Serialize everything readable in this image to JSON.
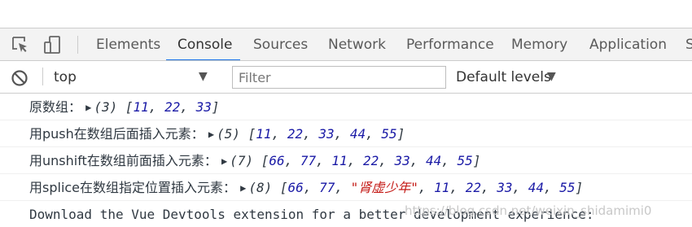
{
  "tabs": [
    {
      "label": "Elements",
      "active": false
    },
    {
      "label": "Console",
      "active": true
    },
    {
      "label": "Sources",
      "active": false
    },
    {
      "label": "Network",
      "active": false
    },
    {
      "label": "Performance",
      "active": false
    },
    {
      "label": "Memory",
      "active": false
    },
    {
      "label": "Application",
      "active": false
    },
    {
      "label": "S",
      "active": false
    }
  ],
  "toolbar": {
    "context": "top",
    "filter_placeholder": "Filter",
    "levels_label": "Default levels"
  },
  "icons": {
    "inspect": "inspect-element-icon",
    "device": "device-toolbar-icon",
    "clear": "clear-console-icon",
    "expand": "expand-triangle-icon"
  },
  "colors": {
    "number": "#1a1aa6",
    "string": "#c41a16",
    "active_tab_underline": "#1a73e8"
  },
  "console_lines": [
    {
      "message": "原数组：",
      "count": 3,
      "items": [
        {
          "type": "number",
          "value": "11"
        },
        {
          "type": "number",
          "value": "22"
        },
        {
          "type": "number",
          "value": "33"
        }
      ]
    },
    {
      "message": "用push在数组后面插入元素：",
      "count": 5,
      "items": [
        {
          "type": "number",
          "value": "11"
        },
        {
          "type": "number",
          "value": "22"
        },
        {
          "type": "number",
          "value": "33"
        },
        {
          "type": "number",
          "value": "44"
        },
        {
          "type": "number",
          "value": "55"
        }
      ]
    },
    {
      "message": "用unshift在数组前面插入元素：",
      "count": 7,
      "items": [
        {
          "type": "number",
          "value": "66"
        },
        {
          "type": "number",
          "value": "77"
        },
        {
          "type": "number",
          "value": "11"
        },
        {
          "type": "number",
          "value": "22"
        },
        {
          "type": "number",
          "value": "33"
        },
        {
          "type": "number",
          "value": "44"
        },
        {
          "type": "number",
          "value": "55"
        }
      ]
    },
    {
      "message": "用splice在数组指定位置插入元素：",
      "count": 8,
      "items": [
        {
          "type": "number",
          "value": "66"
        },
        {
          "type": "number",
          "value": "77"
        },
        {
          "type": "string",
          "value": "肾虚少年"
        },
        {
          "type": "number",
          "value": "11"
        },
        {
          "type": "number",
          "value": "22"
        },
        {
          "type": "number",
          "value": "33"
        },
        {
          "type": "number",
          "value": "44"
        },
        {
          "type": "number",
          "value": "55"
        }
      ]
    }
  ],
  "info_line": "Download the Vue Devtools extension for a better development experience:",
  "watermark": "https://blog.csdn.net/weixin_shidamimi0"
}
